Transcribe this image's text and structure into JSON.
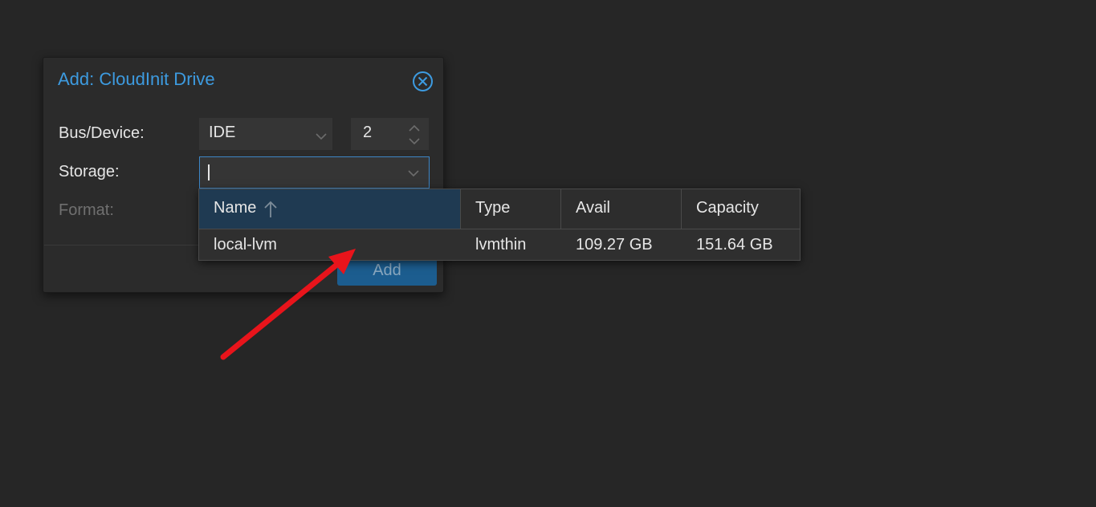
{
  "dialog": {
    "title": "Add: CloudInit Drive",
    "close_icon": "close-circle-icon",
    "fields": {
      "bus_device_label": "Bus/Device:",
      "bus_value": "IDE",
      "device_number": "2",
      "storage_label": "Storage:",
      "storage_value": "",
      "format_label": "Format:"
    },
    "add_button": "Add"
  },
  "storage_picker": {
    "columns": [
      "Name",
      "Type",
      "Avail",
      "Capacity"
    ],
    "sorted_column": "Name",
    "sort_direction": "ascending",
    "rows": [
      {
        "name": "local-lvm",
        "type": "lvmthin",
        "avail": "109.27 GB",
        "capacity": "151.64 GB"
      }
    ]
  },
  "annotation": {
    "arrow_color": "#e8141b"
  },
  "colors": {
    "accent": "#3d9be0",
    "background": "#262626",
    "header_sorted": "#1f3a52",
    "button": "#1c5d8f"
  }
}
